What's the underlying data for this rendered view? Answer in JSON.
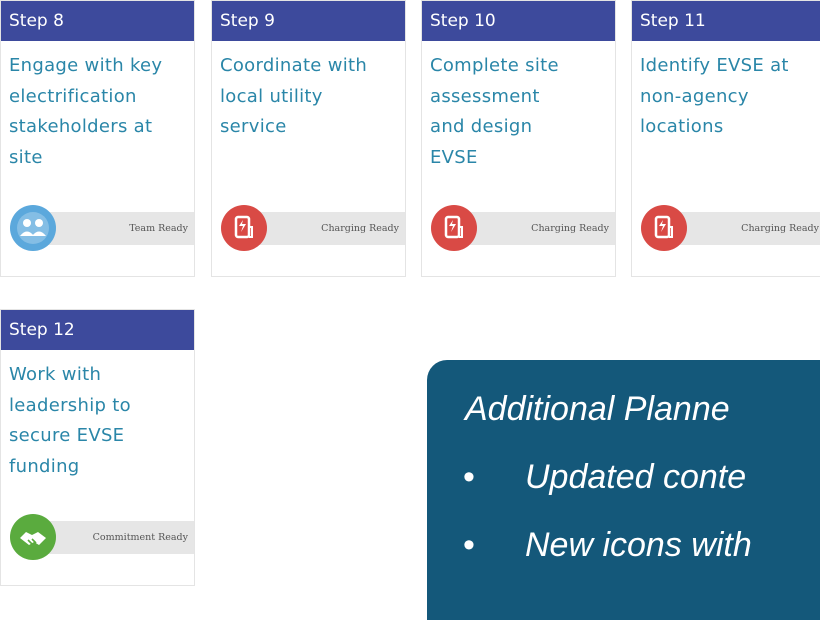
{
  "cards": [
    {
      "step": "Step 8",
      "lines": [
        "Engage with key",
        "electrification",
        "stakeholders at",
        "site"
      ],
      "badge": "Team Ready",
      "icon": "team-icon",
      "color": "#5ba8dc"
    },
    {
      "step": "Step 9",
      "lines": [
        "Coordinate with",
        "local utility",
        "service"
      ],
      "badge": "Charging Ready",
      "icon": "ev-charger-icon",
      "color": "#d94a45"
    },
    {
      "step": "Step 10",
      "lines": [
        "Complete site",
        "assessment",
        "and design",
        "EVSE"
      ],
      "badge": "Charging Ready",
      "icon": "ev-charger-icon",
      "color": "#d94a45"
    },
    {
      "step": "Step 11",
      "lines": [
        "Identify EVSE at",
        "non-agency",
        "locations"
      ],
      "badge": "Charging Ready",
      "icon": "ev-charger-icon",
      "color": "#d94a45"
    },
    {
      "step": "Step 12",
      "lines": [
        "Work with",
        "leadership to",
        "secure EVSE",
        "funding"
      ],
      "badge": "Commitment Ready",
      "icon": "handshake-icon",
      "color": "#5aab3e"
    }
  ],
  "promo": {
    "title": "Additional Planne",
    "items": [
      "Updated conte",
      "New icons with"
    ],
    "bullet": "•"
  }
}
